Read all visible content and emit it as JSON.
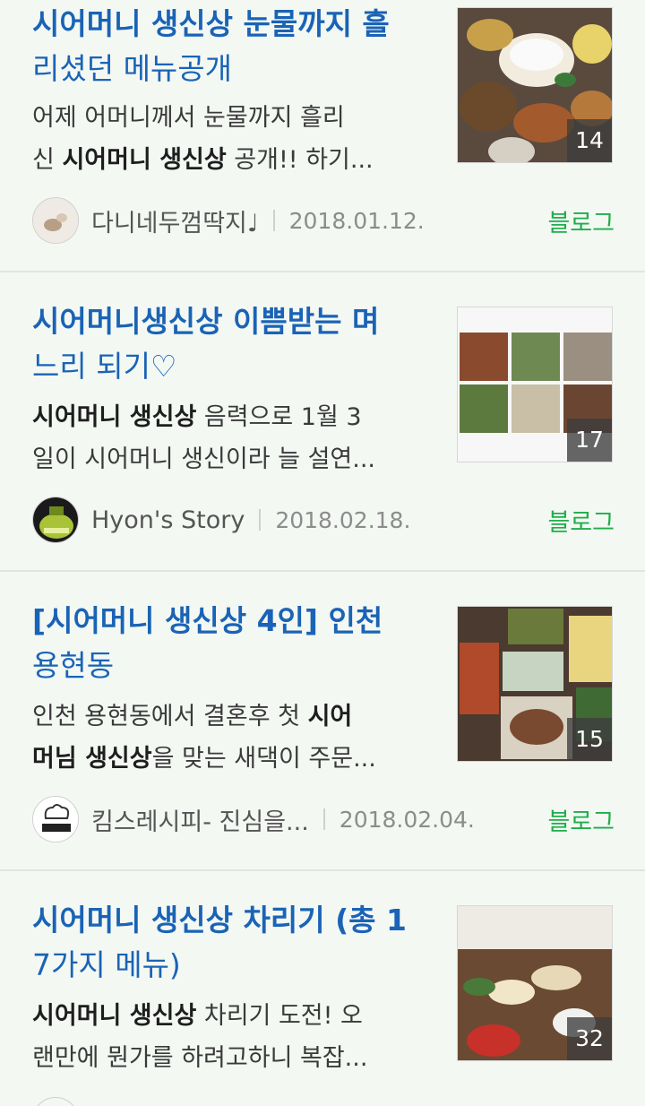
{
  "results": [
    {
      "title_line1": "시어머니 생신상 눈물까지 흘",
      "title_line2": "리셨던 메뉴공개",
      "snippet_line1": "어제 어머니께서 눈물까지 흘리",
      "snippet_line2_pre": "신 ",
      "snippet_line2_bold": "시어머니 생신상",
      "snippet_line2_post": " 공개!! 하기...",
      "author": "다니네두껌딱지♩",
      "date": "2018.01.12.",
      "source": "블로그",
      "image_count": "14"
    },
    {
      "title_line1": "시어머니생신상 이쁨받는 며",
      "title_line2": "느리 되기♡",
      "snippet_line1_bold": "시어머니 생신상",
      "snippet_line1_post": " 음력으로 1월 3",
      "snippet_line2": "일이 시어머니 생신이라 늘 설연...",
      "author": "Hyon's Story",
      "date": "2018.02.18.",
      "source": "블로그",
      "image_count": "17"
    },
    {
      "title_line1": "[시어머니 생신상 4인] 인천",
      "title_line2": "용현동",
      "snippet_line1_pre": "인천 용현동에서 결혼후 첫 ",
      "snippet_line1_bold": "시어",
      "snippet_line2_bold": "머님 생신상",
      "snippet_line2_post": "을 맞는 새댁이 주문...",
      "author": "킴스레시피- 진심을...",
      "date": "2018.02.04.",
      "source": "블로그",
      "image_count": "15"
    },
    {
      "title_line1": "시어머니 생신상 차리기 (총 1",
      "title_line2": "7가지 메뉴)",
      "snippet_line1_bold": "시어머니 생신상",
      "snippet_line1_post": " 차리기 도전! 오",
      "snippet_line2": "랜만에 뭔가를 하려고하니 복잡...",
      "image_count": "32"
    }
  ],
  "icons": {
    "avatar1": "avatar-icon",
    "avatar2": "avatar-icon",
    "avatar3": "avatar-icon"
  },
  "colors": {
    "title": "#1a63b6",
    "source": "#1fae4a",
    "background": "#f3f8f3"
  }
}
